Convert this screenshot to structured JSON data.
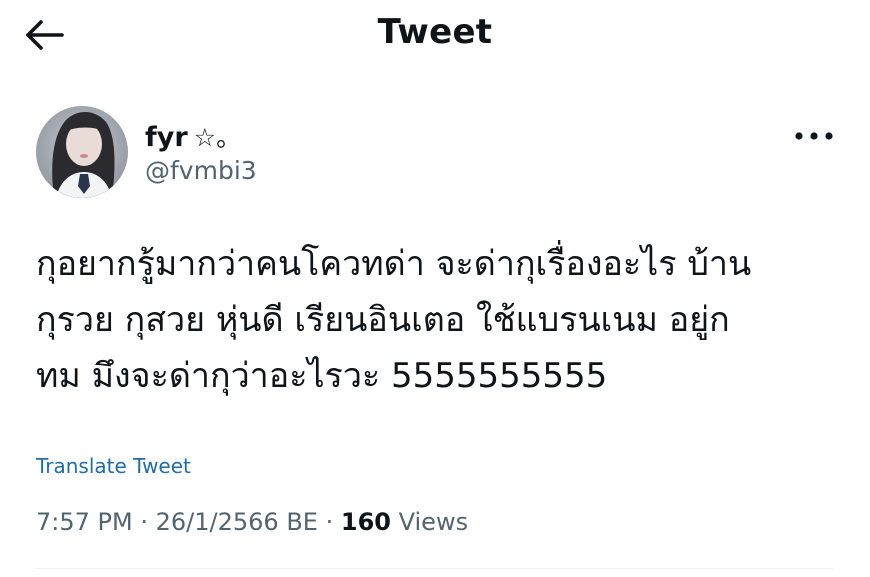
{
  "header": {
    "title": "Tweet",
    "back_icon": "arrow-left-icon"
  },
  "author": {
    "display_name": "fyr",
    "name_decoration": "☆。",
    "handle": "@fvmbi3",
    "avatar_icon": "profile-photo"
  },
  "more_icon": "more-horizontal-icon",
  "tweet": {
    "lines": [
      "กุอยากรู้มากว่าคนโควทด่า จะด่ากุเรื่องอะไร บ้าน",
      "กุรวย กุสวย หุ่นดี เรียนอินเตอ  ใช้แบรนเนม อยู่ก",
      "ทม มึงจะด่ากุว่าอะไรวะ 5555555555"
    ]
  },
  "translate_label": "Translate Tweet",
  "meta": {
    "time": "7:57 PM",
    "separator": "·",
    "date": "26/1/2566 BE",
    "views_count": "160",
    "views_label": "Views"
  },
  "colors": {
    "text_primary": "#0f1419",
    "text_secondary": "#536471",
    "link": "#1d6ea8",
    "divider": "#eff3f4"
  }
}
